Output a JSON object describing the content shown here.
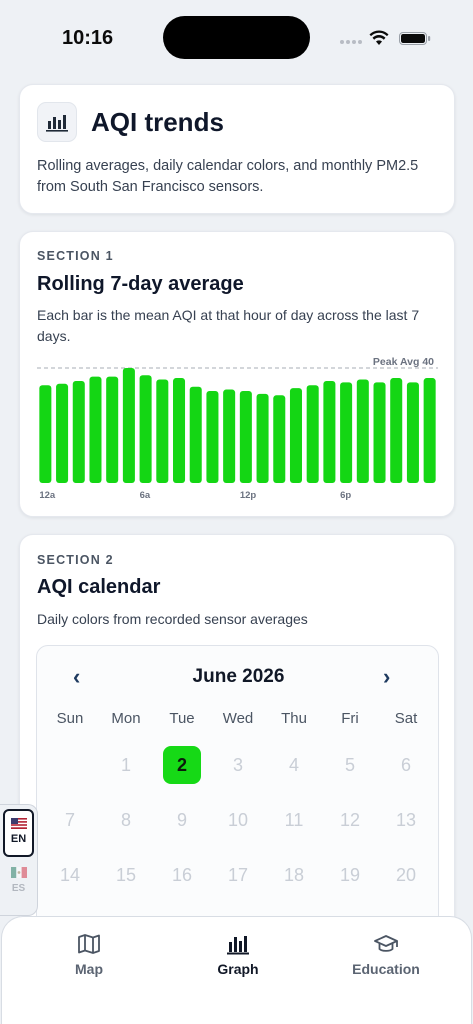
{
  "status": {
    "time": "10:16"
  },
  "hero": {
    "title": "AQI trends",
    "subtitle": "Rolling averages, daily calendar colors, and monthly PM2.5 from South San Francisco sensors."
  },
  "rolling": {
    "eyebrow": "SECTION 1",
    "title": "Rolling 7-day average",
    "description": "Each bar is the mean AQI at that hour of day across the last 7 days."
  },
  "chart_data": {
    "type": "bar",
    "categories": [
      "0",
      "1",
      "2",
      "3",
      "4",
      "5",
      "6",
      "7",
      "8",
      "9",
      "10",
      "11",
      "12",
      "13",
      "14",
      "15",
      "16",
      "17",
      "18",
      "19",
      "20",
      "21",
      "22",
      "23"
    ],
    "tick_labels": [
      {
        "index": 0,
        "label": "12a"
      },
      {
        "index": 6,
        "label": "6a"
      },
      {
        "index": 12,
        "label": "12p"
      },
      {
        "index": 18,
        "label": "6p"
      }
    ],
    "values": [
      34,
      34.5,
      35.5,
      37,
      37,
      40,
      37.5,
      36,
      36.5,
      33.5,
      32,
      32.5,
      32,
      31,
      30.5,
      33,
      34,
      35.5,
      35,
      36,
      35,
      36.5,
      35,
      36.5
    ],
    "reference_line": {
      "value": 40,
      "label": "Peak Avg 40"
    },
    "ylim": [
      0,
      40
    ],
    "color": "#14d614",
    "grid": false
  },
  "calendar": {
    "eyebrow": "SECTION 2",
    "title": "AQI calendar",
    "description": "Daily colors from recorded sensor averages",
    "month_label": "June 2026",
    "prev_label": "‹",
    "next_label": "›",
    "weekdays": [
      "Sun",
      "Mon",
      "Tue",
      "Wed",
      "Thu",
      "Fri",
      "Sat"
    ],
    "days": [
      [
        "",
        "1",
        "2",
        "3",
        "4",
        "5",
        "6"
      ],
      [
        "7",
        "8",
        "9",
        "10",
        "11",
        "12",
        "13"
      ],
      [
        "14",
        "15",
        "16",
        "17",
        "18",
        "19",
        "20"
      ]
    ],
    "active_day": "2",
    "active_color": "#16d916"
  },
  "language": {
    "en_label": "EN",
    "es_label": "ES",
    "selected": "EN"
  },
  "tabs": [
    {
      "label": "Map",
      "icon": "map-icon"
    },
    {
      "label": "Graph",
      "icon": "bar-chart-icon",
      "active": true
    },
    {
      "label": "Education",
      "icon": "graduation-cap-icon"
    }
  ]
}
